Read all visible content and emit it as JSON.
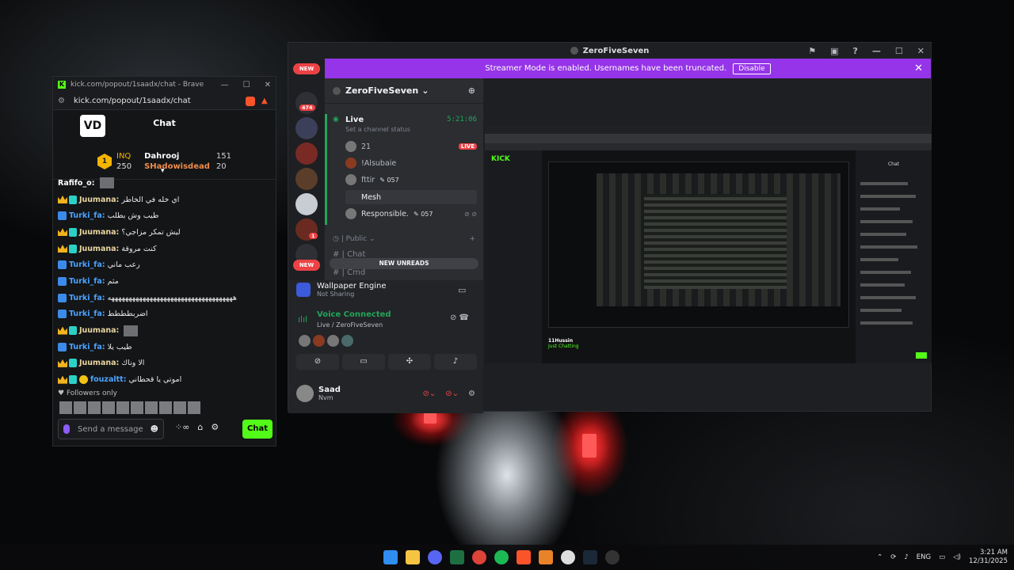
{
  "brave": {
    "title": "kick.com/popout/1saadx/chat - Brave",
    "url": "kick.com/popout/1saadx/chat",
    "chat_title": "Chat",
    "logo": "VD",
    "leader": {
      "name": "INQ",
      "points": "250",
      "top1": {
        "name": "Dahrooj",
        "value": "151"
      },
      "top2": {
        "name": "SHadowisdead",
        "value": "20"
      }
    },
    "messages": [
      {
        "user": "Rafifo_o:",
        "text": "",
        "color": "#ffffff",
        "badges": []
      },
      {
        "user": "Juumana:",
        "text": "اي خله في الخاطر",
        "color": "#e9d5a0",
        "badges": [
          "crown",
          "vip"
        ]
      },
      {
        "user": "Turki_fa:",
        "text": "طيب وش بطلب",
        "color": "#4aa3ff",
        "badges": [
          "mod"
        ]
      },
      {
        "user": "Juumana:",
        "text": "ليش تمكر مزاجي؟",
        "color": "#e9d5a0",
        "badges": [
          "crown",
          "vip"
        ]
      },
      {
        "user": "Juumana:",
        "text": "كنت مروقة",
        "color": "#e9d5a0",
        "badges": [
          "crown",
          "vip"
        ]
      },
      {
        "user": "Turki_fa:",
        "text": "رعب ماني",
        "color": "#4aa3ff",
        "badges": [
          "mod"
        ]
      },
      {
        "user": "Turki_fa:",
        "text": "مثم",
        "color": "#4aa3ff",
        "badges": [
          "mod"
        ]
      },
      {
        "user": "Turki_fa:",
        "text": "ههههههههههههههههههههههههههههههههههههه",
        "color": "#4aa3ff",
        "badges": [
          "mod"
        ]
      },
      {
        "user": "Turki_fa:",
        "text": "اضربطططط",
        "color": "#4aa3ff",
        "badges": [
          "mod"
        ]
      },
      {
        "user": "Juumana:",
        "text": "",
        "color": "#e9d5a0",
        "badges": [
          "crown",
          "vip"
        ]
      },
      {
        "user": "Turki_fa:",
        "text": "طيب يلا",
        "color": "#4aa3ff",
        "badges": [
          "mod"
        ]
      },
      {
        "user": "Juumana:",
        "text": "الا وناك",
        "color": "#e9d5a0",
        "badges": [
          "crown",
          "vip"
        ]
      },
      {
        "user": "fouzaltt:",
        "text": "اموتي يا قحطاني",
        "color": "#4aa3ff",
        "badges": [
          "crown",
          "vip",
          "pass"
        ]
      }
    ],
    "followers_only": "Followers only",
    "input_placeholder": "Send a message",
    "chat_button": "Chat"
  },
  "discord": {
    "window_title": "ZeroFiveSeven",
    "streamer_banner": "Streamer Mode is enabled. Usernames have been truncated.",
    "disable_button": "Disable",
    "new_badge": "NEW",
    "guild_badge_474": "474",
    "guild_badge_1": "1",
    "server_name": "ZeroFiveSeven",
    "live_channel": "Live",
    "live_time": "5:21:06",
    "live_status": "Set a channel status",
    "voice_users": [
      {
        "name": "21",
        "live": "LIVE"
      },
      {
        "name": "!Alsubaie"
      },
      {
        "name": "fttir",
        "count": "057"
      },
      {
        "name": "Mesh"
      },
      {
        "name": "Responsible.",
        "count": "057"
      }
    ],
    "category": "Public",
    "channels": [
      "Chat",
      "Cmd"
    ],
    "new_unreads": "NEW UNREADS",
    "activity": {
      "title": "Wallpaper Engine",
      "sub": "Not Sharing"
    },
    "voice": {
      "status": "Voice Connected",
      "channel": "Live / ZeroFiveSeven"
    },
    "user": {
      "name": "Saad",
      "status": "Nvm"
    }
  },
  "stream": {
    "streamer": "11Hussin",
    "category": "Just Chatting",
    "chat_label": "Chat"
  },
  "taskbar": {
    "lang": "ENG",
    "time": "3:21 AM",
    "date": "12/31/2025"
  },
  "colors": {
    "kick_green": "#53fc18",
    "discord_green": "#23a559",
    "discord_red": "#ed4245",
    "banner": "#9534e8"
  }
}
